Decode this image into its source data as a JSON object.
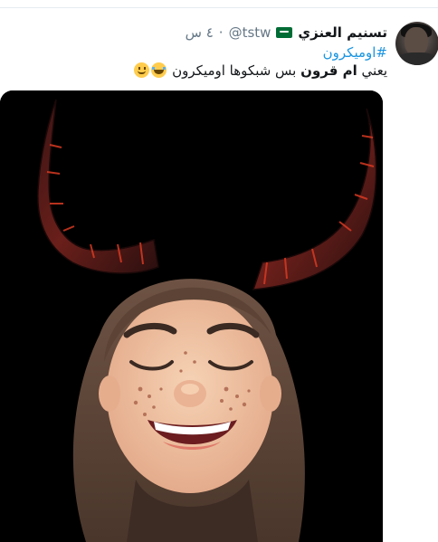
{
  "tweet": {
    "display_name": "تسنيم العنزي",
    "handle": "@tstw",
    "time_ago": "٤ س",
    "separator": "·",
    "hashtag": "#اوميكرون",
    "text_prefix": "يعني ",
    "text_bold": "ام قرون",
    "text_suffix": " بس شبكوها اوميكرون",
    "emojis": [
      "face-with-tears-of-joy",
      "slightly-smiling-face"
    ]
  },
  "media": {
    "description_icon": "memoji-with-horns-image"
  },
  "colors": {
    "link": "#1b95e0",
    "text": "#14171a",
    "muted": "#657786",
    "media_bg": "#000000"
  }
}
